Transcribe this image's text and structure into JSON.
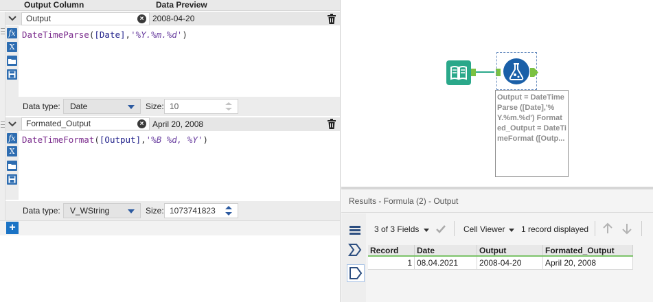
{
  "formula_panel": {
    "headers": {
      "output_column": "Output Column",
      "data_preview": "Data Preview"
    },
    "rows": [
      {
        "name": "Output",
        "preview": "2008-04-20",
        "expr": {
          "fn": "DateTimeParse",
          "open": "(",
          "field": "[Date]",
          "comma": ",",
          "str": "'%Y.%m.%d'",
          "close": ")"
        },
        "datatype_label": "Data type:",
        "datatype": "Date",
        "size_label": "Size:",
        "size": "10"
      },
      {
        "name": "Formated_Output",
        "preview": "April 20, 2008",
        "expr": {
          "fn": "DateTimeFormat",
          "open": "(",
          "field": "[Output]",
          "comma": ",",
          "str": "'%B %d, %Y'",
          "close": ")"
        },
        "datatype_label": "Data type:",
        "datatype": "V_WString",
        "size_label": "Size:",
        "size": "1073741823"
      }
    ],
    "tool_icons": [
      "function-icon",
      "variable-icon",
      "folder-open-icon",
      "save-icon"
    ],
    "add_button": "+"
  },
  "canvas": {
    "annotation": "Output = DateTimeParse ([Date],'%Y.%m.%d') Formated_Output = DateTimeFormat ([Outp..."
  },
  "results": {
    "title": "Results - Formula (2) - Output",
    "fields_selector": "3 of 3 Fields",
    "viewer": "Cell Viewer",
    "record_count": "1 record displayed",
    "columns": [
      "Record",
      "Date",
      "Output",
      "Formated_Output"
    ],
    "rows": [
      [
        "1",
        "08.04.2021",
        "2008-04-20",
        "April 20, 2008"
      ]
    ]
  },
  "colors": {
    "accent_blue": "#2e6db1",
    "tool_green": "#2aa88a",
    "anchor_green": "#7ac142",
    "formula_blue": "#1a5fa8"
  }
}
